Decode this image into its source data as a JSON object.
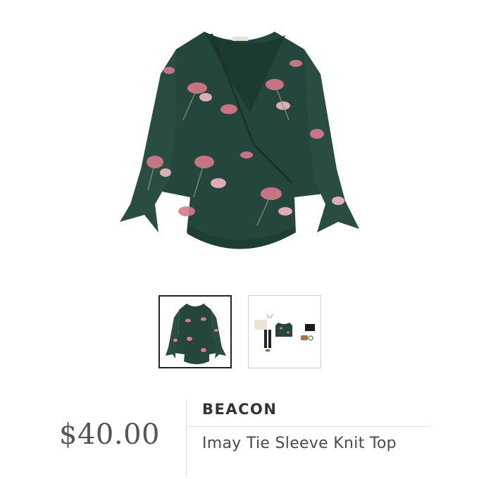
{
  "product": {
    "brand": "BEACON",
    "name": "Imay Tie Sleeve Knit Top",
    "price": "$40.00"
  },
  "gallery": {
    "main_image": "green-floral-wrap-top",
    "thumbnails": [
      {
        "image": "green-floral-wrap-top",
        "selected": true
      },
      {
        "image": "styled-outfit-collage",
        "selected": false
      }
    ]
  },
  "colors": {
    "garment": "#24463c",
    "floral": "#d87a8c",
    "price_text": "#555555",
    "selected_border": "#222222"
  }
}
